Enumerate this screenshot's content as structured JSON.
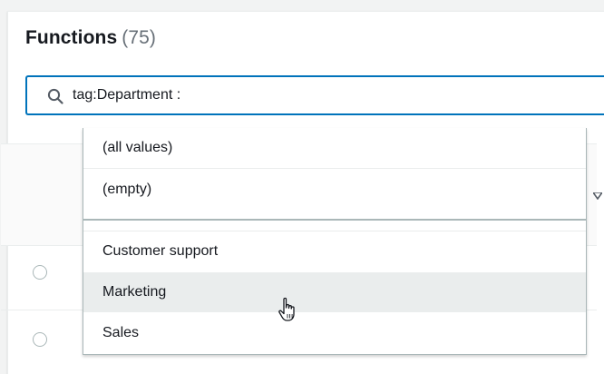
{
  "header": {
    "title": "Functions",
    "count": "(75)"
  },
  "search": {
    "value": "tag:Department :",
    "icon": "search-icon"
  },
  "dropdown": {
    "options": [
      {
        "label": "(all values)"
      },
      {
        "label": "(empty)"
      },
      {
        "label": "Customer support"
      },
      {
        "label": "Marketing",
        "hovered": true
      },
      {
        "label": "Sales"
      }
    ]
  },
  "colors": {
    "accent": "#0073bb",
    "hover": "#eaeded",
    "border": "#aab7b8"
  }
}
